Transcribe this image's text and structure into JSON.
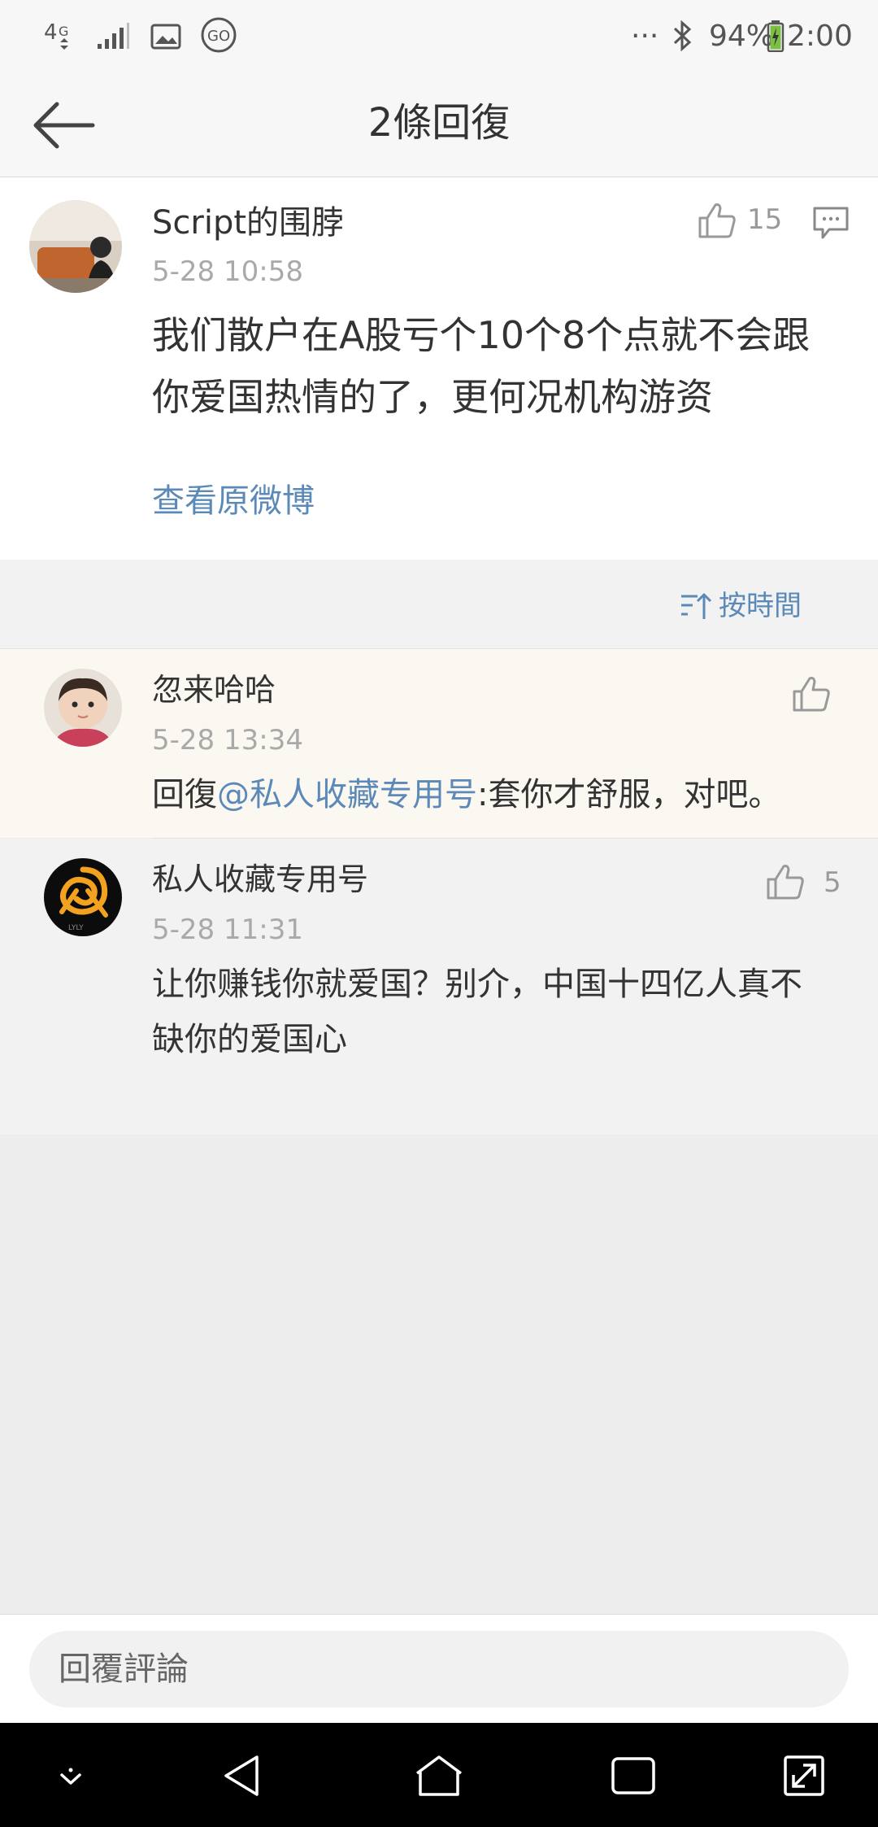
{
  "status_bar": {
    "network": "4G",
    "battery": "94%",
    "time": "2:00",
    "more": "···"
  },
  "header": {
    "title": "2條回復"
  },
  "main_comment": {
    "username": "Script的围脖",
    "timestamp": "5-28 10:58",
    "likes": "15",
    "text_line1": "我们散户在A股亏个10个8个点就不会跟",
    "text_line2": "你爱国热情的了，更何况机构游资",
    "view_original": "查看原微博"
  },
  "sort": {
    "label": "按時間"
  },
  "replies": [
    {
      "username": "忽来哈哈",
      "timestamp": "5-28 13:34",
      "prefix": "回復",
      "mention": "@私人收藏专用号",
      "text": ":套你才舒服，对吧。"
    },
    {
      "username": "私人收藏专用号",
      "timestamp": "5-28 11:31",
      "likes": "5",
      "text_line1": "让你赚钱你就爱国？别介，中国十四亿人真不",
      "text_line2": "缺你的爱国心"
    }
  ],
  "input": {
    "placeholder": "回覆評論"
  },
  "colors": {
    "link_blue": "#5b89b8",
    "highlight_bg": "#fbf8f1",
    "battery_green": "#7bc043"
  },
  "icons": {
    "back": "arrow-left-icon",
    "like": "thumbs-up-icon",
    "comment": "comment-icon",
    "sort": "sort-icon"
  }
}
